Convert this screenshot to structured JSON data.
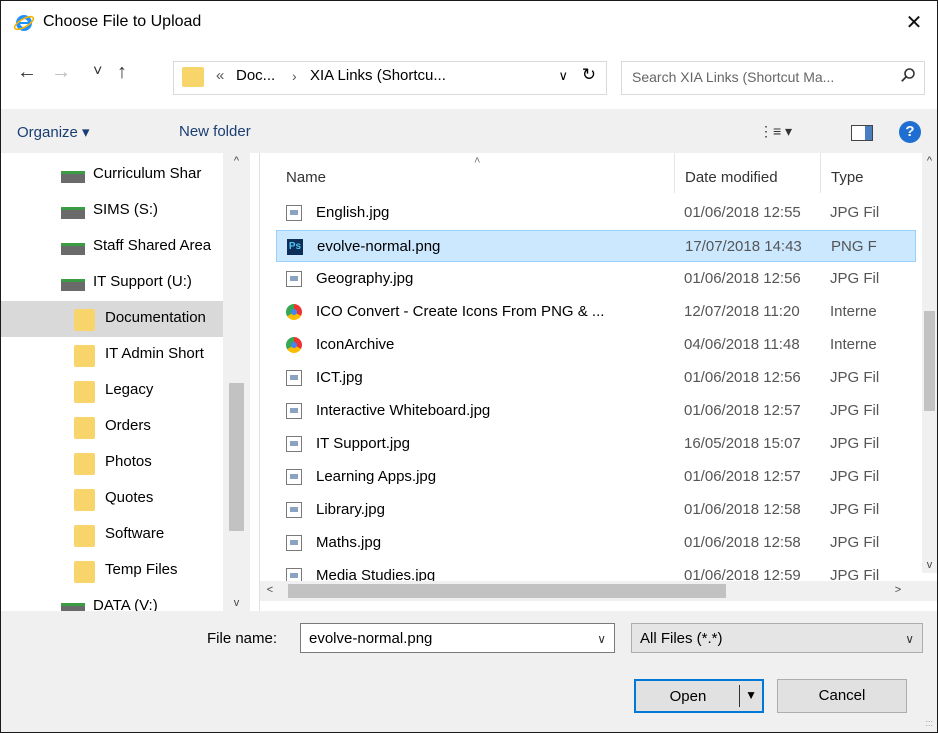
{
  "window": {
    "title": "Choose File to Upload",
    "close_icon": "✕"
  },
  "nav": {
    "back_icon": "←",
    "forward_icon": "→",
    "recent_icon": "˅",
    "up_icon": "↑",
    "address_overflow": "«",
    "address_crumbs": [
      "Doc...",
      "XIA Links (Shortcu..."
    ],
    "address_sep": "›",
    "address_dropdown_icon": "∨",
    "refresh_icon": "↻",
    "search_placeholder": "Search XIA Links (Shortcut Ma..."
  },
  "toolbar": {
    "organize_label": "Organize ▾",
    "new_folder_label": "New folder",
    "view_icon": "⋮≡ ▾",
    "help_label": "?"
  },
  "tree": {
    "items": [
      {
        "label": "Curriculum Shar",
        "kind": "drive"
      },
      {
        "label": "SIMS (S:)",
        "kind": "drive"
      },
      {
        "label": "Staff Shared Area",
        "kind": "drive"
      },
      {
        "label": "IT Support (U:)",
        "kind": "drive"
      },
      {
        "label": "Documentation",
        "kind": "folder",
        "selected": true
      },
      {
        "label": "IT Admin Short",
        "kind": "folder"
      },
      {
        "label": "Legacy",
        "kind": "folder"
      },
      {
        "label": "Orders",
        "kind": "folder"
      },
      {
        "label": "Photos",
        "kind": "folder"
      },
      {
        "label": "Quotes",
        "kind": "folder"
      },
      {
        "label": "Software",
        "kind": "folder"
      },
      {
        "label": "Temp Files",
        "kind": "folder"
      },
      {
        "label": "DATA (V:)",
        "kind": "drive"
      }
    ]
  },
  "list": {
    "columns": {
      "name": "Name",
      "date": "Date modified",
      "type": "Type"
    },
    "sort_icon": "˄",
    "files": [
      {
        "name": "English.jpg",
        "date": "01/06/2018 12:55",
        "type": "JPG Fil",
        "icon": "jpg"
      },
      {
        "name": "evolve-normal.png",
        "date": "17/07/2018 14:43",
        "type": "PNG F",
        "icon": "ps",
        "selected": true
      },
      {
        "name": "Geography.jpg",
        "date": "01/06/2018 12:56",
        "type": "JPG Fil",
        "icon": "jpg"
      },
      {
        "name": "ICO Convert - Create Icons From PNG & ...",
        "date": "12/07/2018 11:20",
        "type": "Interne",
        "icon": "web"
      },
      {
        "name": "IconArchive",
        "date": "04/06/2018 11:48",
        "type": "Interne",
        "icon": "web"
      },
      {
        "name": "ICT.jpg",
        "date": "01/06/2018 12:56",
        "type": "JPG Fil",
        "icon": "jpg"
      },
      {
        "name": "Interactive Whiteboard.jpg",
        "date": "01/06/2018 12:57",
        "type": "JPG Fil",
        "icon": "jpg"
      },
      {
        "name": "IT Support.jpg",
        "date": "16/05/2018 15:07",
        "type": "JPG Fil",
        "icon": "jpg"
      },
      {
        "name": "Learning Apps.jpg",
        "date": "01/06/2018 12:57",
        "type": "JPG Fil",
        "icon": "jpg"
      },
      {
        "name": "Library.jpg",
        "date": "01/06/2018 12:58",
        "type": "JPG Fil",
        "icon": "jpg"
      },
      {
        "name": "Maths.jpg",
        "date": "01/06/2018 12:58",
        "type": "JPG Fil",
        "icon": "jpg"
      },
      {
        "name": "Media Studies.jpg",
        "date": "01/06/2018 12:59",
        "type": "JPG Fil",
        "icon": "jpg"
      }
    ]
  },
  "bottom": {
    "file_name_label": "File name:",
    "file_name_value": "evolve-normal.png",
    "file_name_dropdown_icon": "∨",
    "filter_value": "All Files (*.*)",
    "filter_dropdown_icon": "∨",
    "open_label": "Open",
    "open_arrow_icon": "▼",
    "cancel_label": "Cancel"
  },
  "colors": {
    "selection": "#cce8ff",
    "tree_selection": "#d9d9d9",
    "folder": "#f8d56b",
    "accent": "#0078d7"
  }
}
